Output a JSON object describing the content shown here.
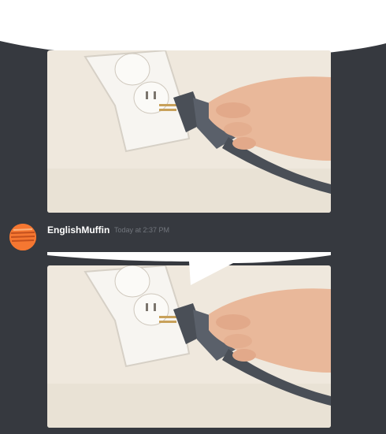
{
  "message": {
    "author": "EnglishMuffin",
    "timestamp": "Today at 2:37 PM"
  },
  "attachments": [
    {
      "icon": "outlet-plug-photo"
    },
    {
      "icon": "outlet-plug-photo"
    }
  ],
  "colors": {
    "background": "#36393f",
    "avatar": "#f57731",
    "username": "#ffffff",
    "timestamp": "#72767d",
    "speech_bubble": "#ffffff"
  }
}
